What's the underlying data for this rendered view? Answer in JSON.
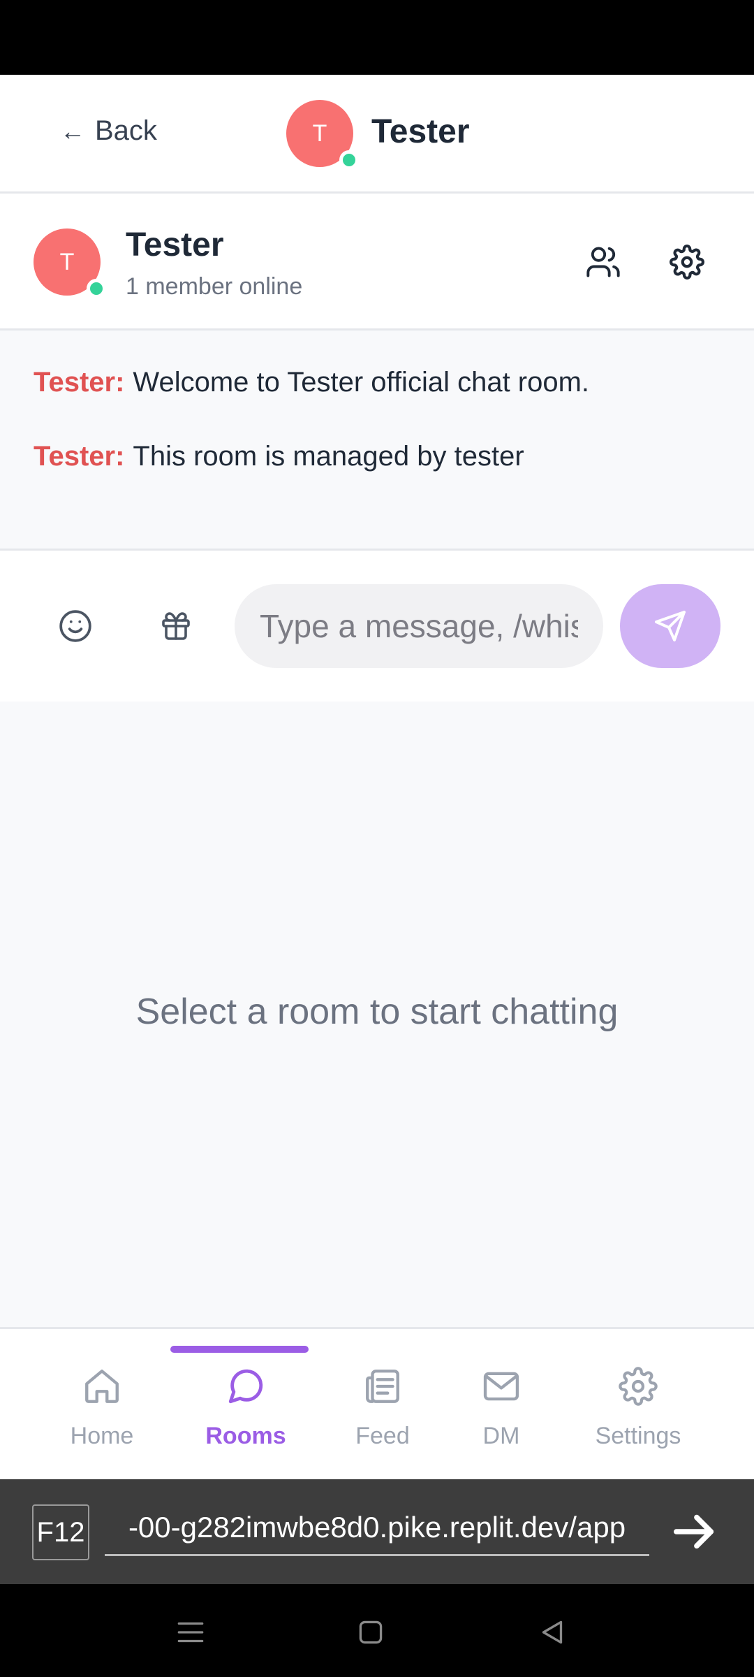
{
  "header": {
    "back_label": "Back",
    "back_arrow": "←",
    "avatar_initial": "T",
    "title": "Tester"
  },
  "room": {
    "avatar_initial": "T",
    "name": "Tester",
    "status": "1 member online"
  },
  "messages": [
    {
      "sender": "Tester:",
      "text": "Welcome to Tester official chat room."
    },
    {
      "sender": "Tester:",
      "text": "This room is managed by tester"
    }
  ],
  "composer": {
    "placeholder": "Type a message, /whisper",
    "emoji_icon": "smile-icon",
    "gift_icon": "gift-icon",
    "send_icon": "send-icon"
  },
  "empty_state": {
    "text": "Select a room to start chatting"
  },
  "nav": {
    "active": "Rooms",
    "items": [
      {
        "label": "Home",
        "icon": "home-icon"
      },
      {
        "label": "Rooms",
        "icon": "chat-bubble-icon"
      },
      {
        "label": "Feed",
        "icon": "newspaper-icon"
      },
      {
        "label": "DM",
        "icon": "mail-icon"
      },
      {
        "label": "Settings",
        "icon": "gear-icon"
      }
    ]
  },
  "browser": {
    "f12_label": "F12",
    "url": "-00-g282imwbe8d0.pike.replit.dev/app"
  },
  "colors": {
    "accent": "#9b5de5",
    "sender": "#e05252",
    "avatar": "#f87171",
    "online": "#34d399",
    "send_button": "#d0b3f5"
  }
}
